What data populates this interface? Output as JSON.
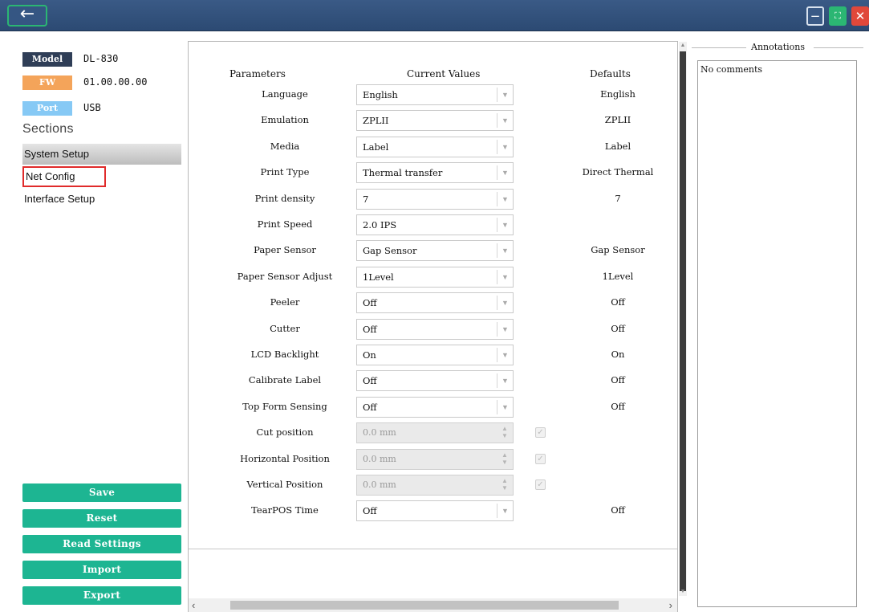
{
  "titlebar": {
    "back_icon": "←",
    "minimize_icon": "−",
    "maximize_icon": "⛶",
    "close_icon": "✕"
  },
  "device_info": {
    "model": {
      "tag": "Model",
      "value": "DL-830",
      "color": "#2f3e57"
    },
    "fw": {
      "tag": "FW",
      "value": "01.00.00.00",
      "color": "#f4a45a"
    },
    "port": {
      "tag": "Port",
      "value": "USB",
      "color": "#86c9f5"
    }
  },
  "sections": {
    "title": "Sections",
    "items": [
      "System Setup",
      "Net Config",
      "Interface Setup"
    ],
    "selected": "System Setup",
    "highlighted": "Net Config"
  },
  "actions": {
    "save": "Save",
    "reset": "Reset",
    "read_settings": "Read Settings",
    "import": "Import",
    "export": "Export",
    "color": "#1db592"
  },
  "table": {
    "headers": {
      "parameters": "Parameters",
      "current_values": "Current Values",
      "defaults": "Defaults"
    },
    "rows": [
      {
        "param": "Language",
        "value": "English",
        "default": "English",
        "kind": "combo"
      },
      {
        "param": "Emulation",
        "value": "ZPLII",
        "default": "ZPLII",
        "kind": "combo"
      },
      {
        "param": "Media",
        "value": "Label",
        "default": "Label",
        "kind": "combo"
      },
      {
        "param": "Print Type",
        "value": "Thermal transfer",
        "default": "Direct Thermal",
        "kind": "combo"
      },
      {
        "param": "Print density",
        "value": "7",
        "default": "7",
        "kind": "combo"
      },
      {
        "param": "Print Speed",
        "value": "2.0 IPS",
        "default": "",
        "kind": "combo"
      },
      {
        "param": "Paper Sensor",
        "value": "Gap Sensor",
        "default": "Gap Sensor",
        "kind": "combo"
      },
      {
        "param": "Paper Sensor Adjust",
        "value": "1Level",
        "default": "1Level",
        "kind": "combo"
      },
      {
        "param": "Peeler",
        "value": "Off",
        "default": "Off",
        "kind": "combo"
      },
      {
        "param": "Cutter",
        "value": "Off",
        "default": "Off",
        "kind": "combo"
      },
      {
        "param": "LCD Backlight",
        "value": "On",
        "default": "On",
        "kind": "combo"
      },
      {
        "param": "Calibrate Label",
        "value": "Off",
        "default": "Off",
        "kind": "combo"
      },
      {
        "param": "Top Form Sensing",
        "value": "Off",
        "default": "Off",
        "kind": "combo"
      },
      {
        "param": "Cut position",
        "value": "0.0 mm",
        "default": "",
        "kind": "spin",
        "checked": true
      },
      {
        "param": "Horizontal Position",
        "value": "0.0 mm",
        "default": "",
        "kind": "spin",
        "checked": true
      },
      {
        "param": "Vertical Position",
        "value": "0.0 mm",
        "default": "",
        "kind": "spin",
        "checked": true
      },
      {
        "param": "TearPOS Time",
        "value": "Off",
        "default": "Off",
        "kind": "combo"
      }
    ]
  },
  "annotations": {
    "title": "Annotations",
    "text": "No comments"
  }
}
